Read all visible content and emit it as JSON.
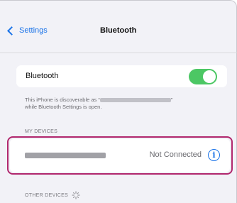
{
  "nav": {
    "back_label": "Settings",
    "title": "Bluetooth"
  },
  "bluetooth": {
    "label": "Bluetooth",
    "enabled": true,
    "footnote_line1_prefix": "This iPhone is discoverable as “",
    "footnote_line1_suffix": "”",
    "footnote_line2": "while Bluetooth Settings is open."
  },
  "my_devices": {
    "header": "MY DEVICES",
    "devices": [
      {
        "status": "Not Connected",
        "info_icon": "info-icon"
      }
    ]
  },
  "other_devices": {
    "header": "OTHER DEVICES",
    "icon": "spinner-icon"
  },
  "colors": {
    "accent": "#1a73e8",
    "toggle_on": "#4cc764",
    "highlight": "#b1276d"
  }
}
